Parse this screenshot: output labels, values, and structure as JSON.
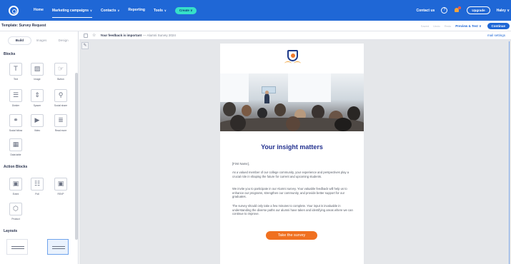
{
  "nav": {
    "links": [
      "Home",
      "Marketing campaigns",
      "Contacts",
      "Reporting",
      "Tools"
    ],
    "create": "Create",
    "contact": "Contact us",
    "upgrade": "Upgrade",
    "user": "Haley"
  },
  "template": {
    "title": "Template: Survey Request",
    "undo": "Saved",
    "undo2": "Undo",
    "redo": "Redo",
    "preview": "Preview & Test",
    "continue": "Continue"
  },
  "sidebar": {
    "tabs": [
      "Build",
      "Images",
      "Design"
    ],
    "blocks_title": "Blocks",
    "blocks": [
      {
        "label": "Text",
        "icon": "text-icon",
        "glyph": "T"
      },
      {
        "label": "Image",
        "icon": "image-icon",
        "glyph": "▨"
      },
      {
        "label": "Button",
        "icon": "button-icon",
        "glyph": "☞"
      },
      {
        "label": "Divider",
        "icon": "divider-icon",
        "glyph": "☰"
      },
      {
        "label": "Spacer",
        "icon": "spacer-icon",
        "glyph": "⇕"
      },
      {
        "label": "Social share",
        "icon": "social-share-icon",
        "glyph": "⚲"
      },
      {
        "label": "Social follow",
        "icon": "social-follow-icon",
        "glyph": "⚭"
      },
      {
        "label": "Video",
        "icon": "video-icon",
        "glyph": "▶"
      },
      {
        "label": "Read more",
        "icon": "read-more-icon",
        "glyph": "≣"
      },
      {
        "label": "Data table",
        "icon": "data-table-icon",
        "glyph": "▦"
      }
    ],
    "action_title": "Action Blocks",
    "action_blocks": [
      {
        "label": "Event",
        "icon": "event-icon",
        "glyph": "▣"
      },
      {
        "label": "Poll",
        "icon": "poll-icon",
        "glyph": "☷"
      },
      {
        "label": "RSVP",
        "icon": "rsvp-icon",
        "glyph": "▣"
      },
      {
        "label": "Product",
        "icon": "product-icon",
        "glyph": "⬡"
      }
    ],
    "layouts_title": "Layouts"
  },
  "canvas": {
    "subject": "Your feedback is important",
    "preheader": "— Alumni Survey 2024",
    "mail_settings": "mail settings"
  },
  "email": {
    "title": "Your insight matters",
    "greeting": "[First Name],",
    "p1": "As a valued member of our college community, your experience and perspectives play a crucial role in shaping the future for current and upcoming students.",
    "p2": "We invite you to participate in our Alumni survey. Your valuable feedback will help us to enhance our programs, strengthen our community, and provide better support for our graduates.",
    "p3": "The survey should only take a few minutes to complete. Your input is invaluable in understanding the diverse paths our alumni have taken and identifying areas where we can continue to improve.",
    "cta": "Take the survey"
  },
  "colors": {
    "brand": "#1f67d6",
    "create": "#36e0c8",
    "title": "#23318f",
    "cta": "#f07020"
  }
}
